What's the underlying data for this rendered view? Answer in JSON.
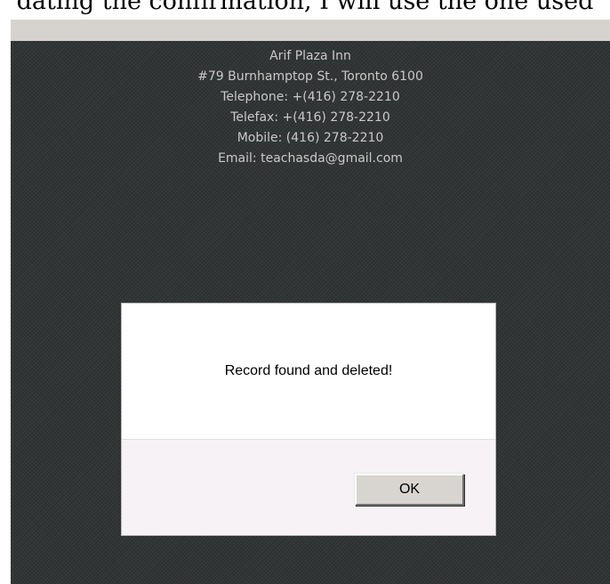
{
  "background_caption": "dating the confirmation, I will use the one used",
  "hotel": {
    "name": "Arif Plaza Inn",
    "address": "#79 Burnhamptop St., Toronto 6100",
    "telephone": "Telephone:  +(416) 278-2210",
    "telefax": "Telefax:  +(416) 278-2210",
    "mobile": "Mobile: (416) 278-2210",
    "email": "Email: teachasda@gmail.com"
  },
  "dialog": {
    "message": "Record found and deleted!",
    "ok_label": "OK"
  },
  "colors": {
    "window_background": "#333637",
    "title_strip": "#d6d3ce",
    "info_text": "#c9c9c9",
    "dialog_footer": "#f6f2f6",
    "button_face": "#d8d5d0"
  }
}
